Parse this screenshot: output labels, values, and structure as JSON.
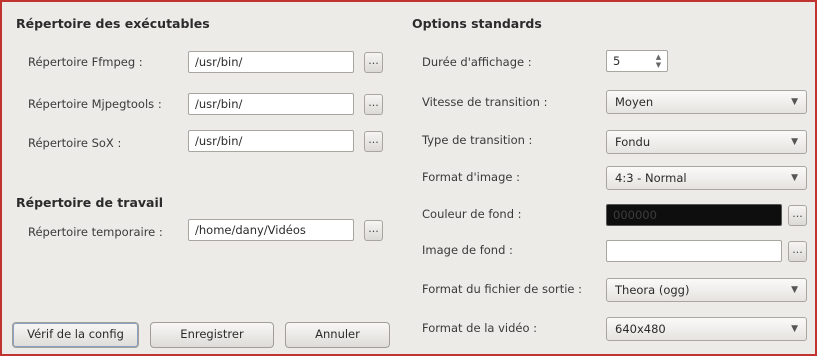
{
  "left": {
    "executables_title": "Répertoire des exécutables",
    "ffmpeg": {
      "label": "Répertoire Ffmpeg :",
      "value": "/usr/bin/"
    },
    "mjpegtools": {
      "label": "Répertoire Mjpegtools :",
      "value": "/usr/bin/"
    },
    "sox": {
      "label": "Répertoire SoX :",
      "value": "/usr/bin/"
    },
    "work_title": "Répertoire de travail",
    "temp": {
      "label": "Répertoire temporaire :",
      "value": "/home/dany/Vidéos"
    },
    "browse_label": "..."
  },
  "right": {
    "title": "Options standards",
    "duration": {
      "label": "Durée d'affichage :",
      "value": "5"
    },
    "speed": {
      "label": "Vitesse de transition :",
      "value": "Moyen"
    },
    "transition": {
      "label": "Type de transition :",
      "value": "Fondu"
    },
    "image_format": {
      "label": "Format d'image :",
      "value": "4:3 - Normal"
    },
    "bg_color": {
      "label": "Couleur de fond :",
      "value": "000000"
    },
    "bg_image": {
      "label": "Image de fond :",
      "value": ""
    },
    "output_format": {
      "label": "Format du fichier de sortie :",
      "value": "Theora (ogg)"
    },
    "video_format": {
      "label": "Format de la vidéo :",
      "value": "640x480"
    },
    "browse_label": "..."
  },
  "buttons": {
    "verify": "Vérif de la config",
    "save": "Enregistrer",
    "cancel": "Annuler"
  },
  "colors": {
    "accent_border": "#c0332f",
    "panel": "#ecebe8",
    "bg_swatch": "#000000"
  }
}
